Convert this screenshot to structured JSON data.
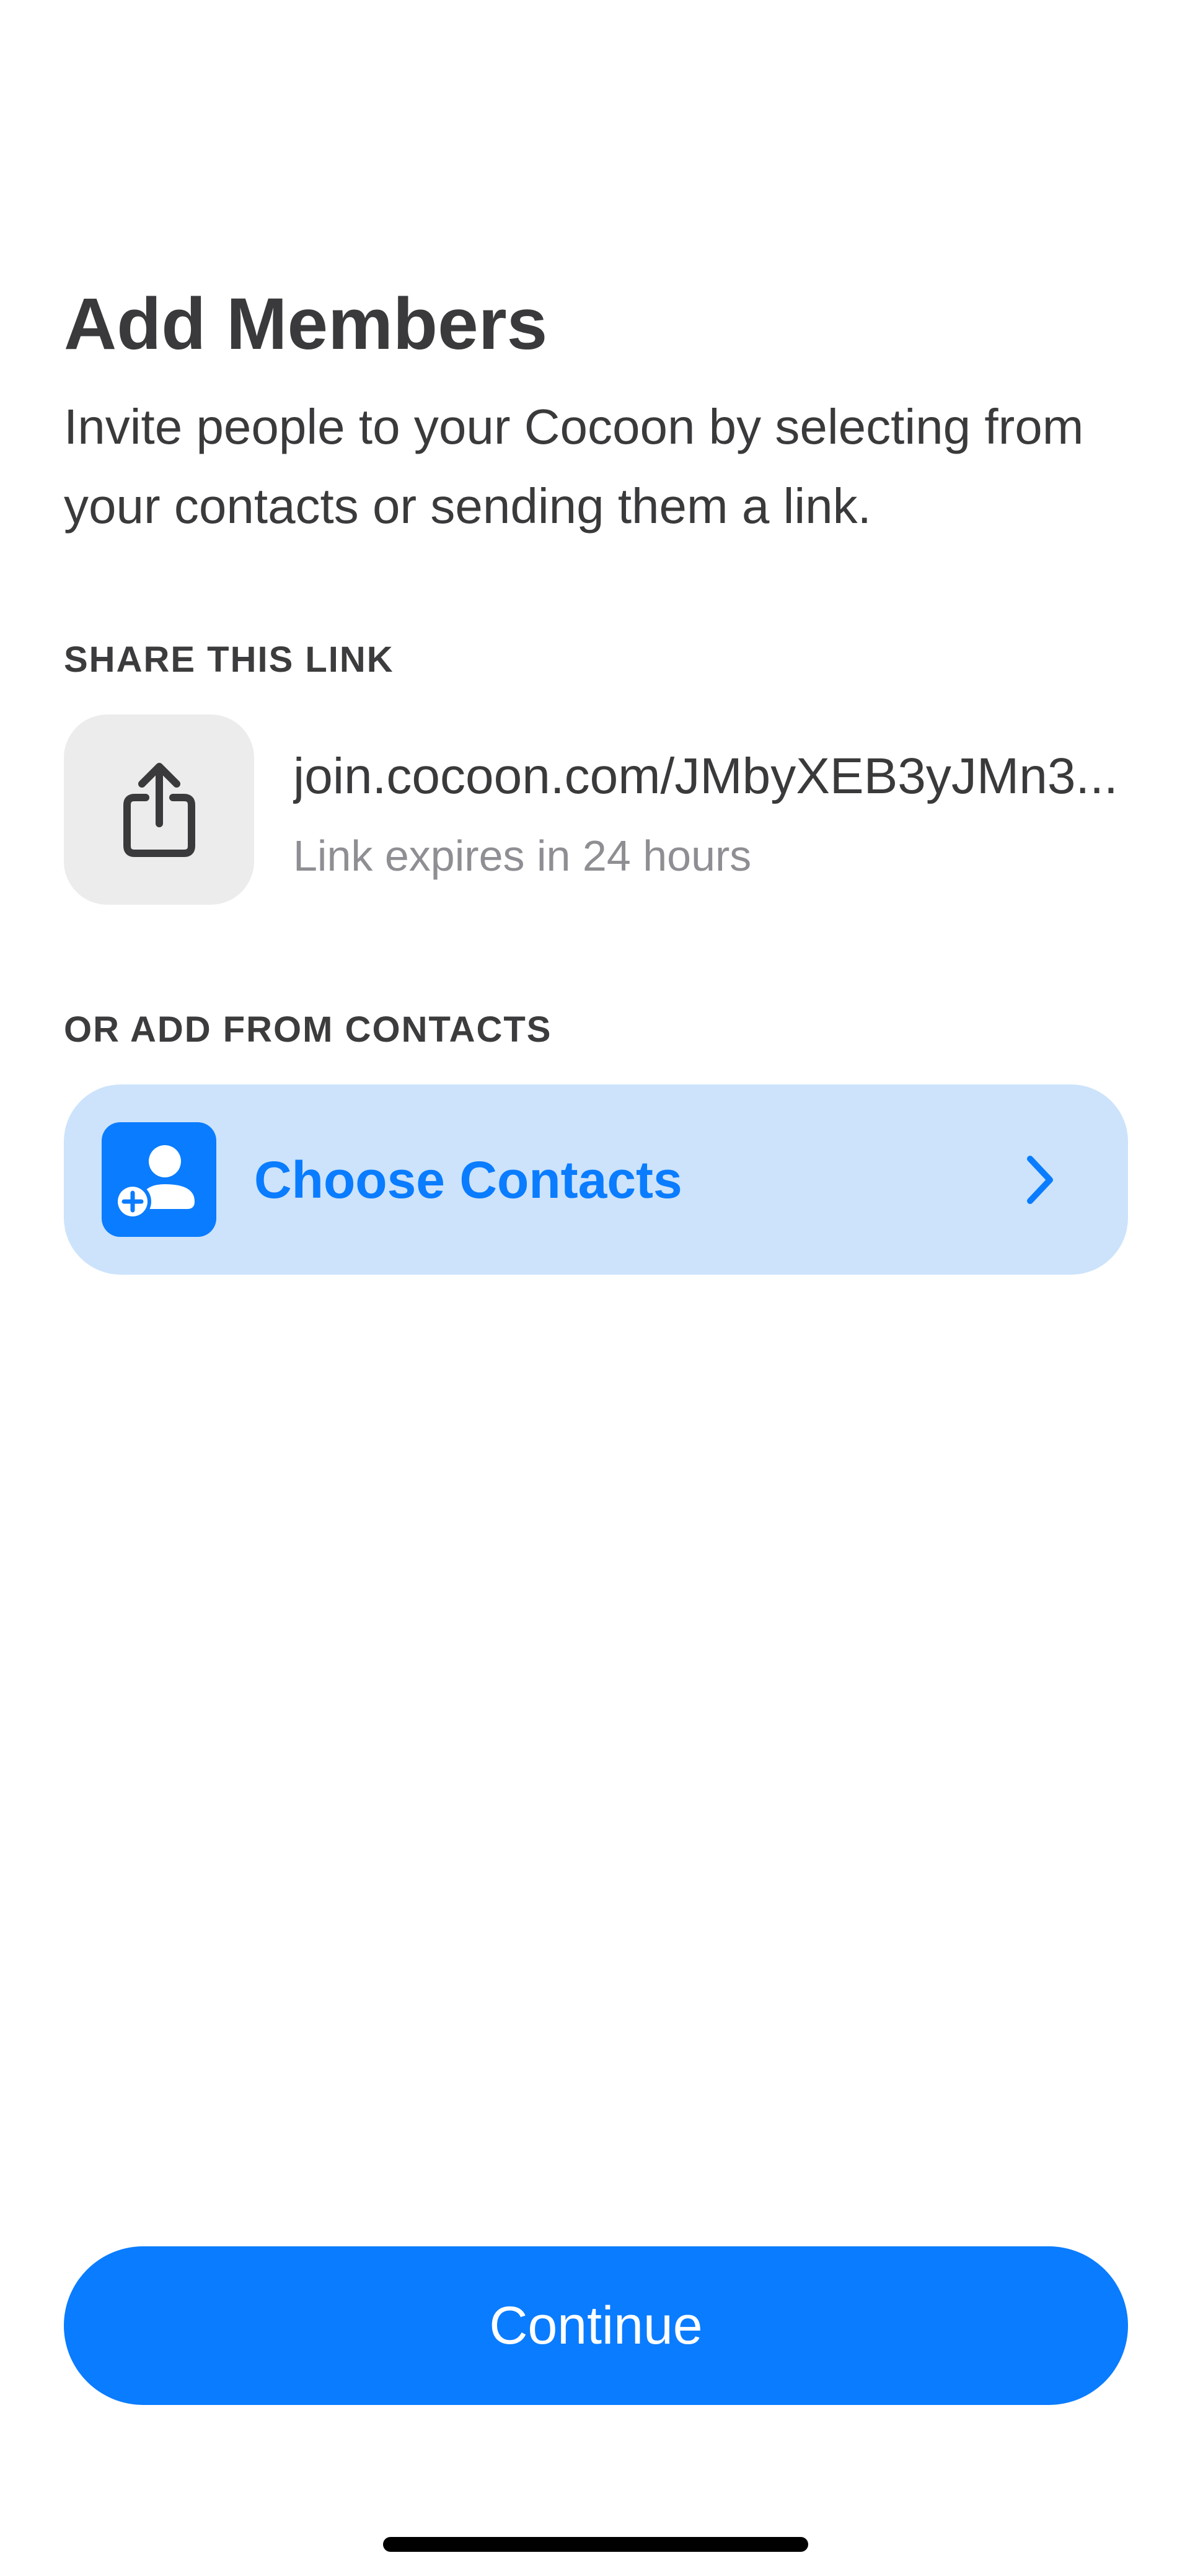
{
  "header": {
    "title": "Add Members",
    "subtitle": "Invite people to your Cocoon by selecting from your contacts or sending them a link."
  },
  "share_section": {
    "label": "SHARE THIS LINK",
    "share_icon": "share-icon",
    "link": "join.cocoon.com/JMbyXEB3yJMn3...",
    "expiry": "Link expires in 24 hours"
  },
  "contacts_section": {
    "label": "OR ADD FROM CONTACTS",
    "button_label": "Choose Contacts",
    "button_icon": "add-person-icon",
    "chevron_icon": "chevron-right-icon"
  },
  "footer": {
    "continue_label": "Continue"
  },
  "colors": {
    "accent": "#0A7CFF",
    "accent_light": "#CCE3FB",
    "tile_gray": "#ECECEC",
    "secondary_text": "#8E8E93"
  }
}
